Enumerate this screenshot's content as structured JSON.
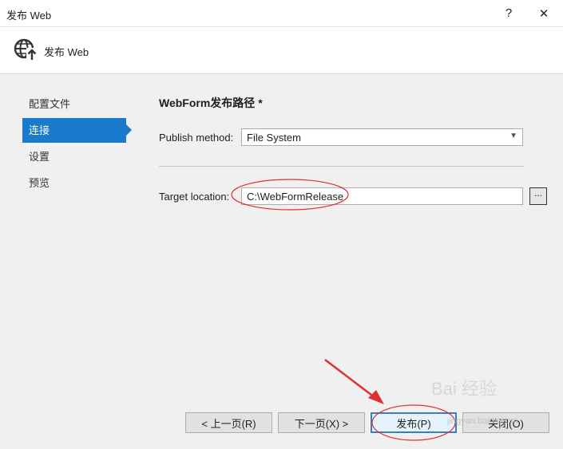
{
  "window": {
    "title": "发布 Web",
    "help_glyph": "?",
    "close_glyph": "✕"
  },
  "header": {
    "title": "发布 Web",
    "icon": "globe-publish-icon"
  },
  "nav": {
    "items": [
      {
        "label": "配置文件",
        "active": false
      },
      {
        "label": "连接",
        "active": true
      },
      {
        "label": "设置",
        "active": false
      },
      {
        "label": "预览",
        "active": false
      }
    ]
  },
  "main": {
    "section_title": "WebForm发布路径 *",
    "publish_method_label": "Publish method:",
    "publish_method_value": "File System",
    "target_location_label": "Target location:",
    "target_location_value": "C:\\WebFormRelease",
    "browse_label": "..."
  },
  "buttons": {
    "prev": "< 上一页(R)",
    "next": "下一页(X) >",
    "publish": "发布(P)",
    "close": "关闭(O)"
  },
  "annotations": {
    "color": "#e03030"
  },
  "colors": {
    "accent": "#1a7acb",
    "annotation": "#e03030"
  },
  "watermark": {
    "text": "Bai 经验",
    "sub": "jingyan.baidu.com"
  }
}
